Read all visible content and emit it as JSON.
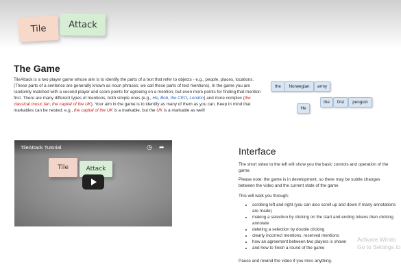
{
  "hero": {
    "logo_tiles": [
      "Tile",
      "Attack"
    ]
  },
  "game": {
    "title": "The Game",
    "intro": [
      {
        "t": "TileAttack is a two player game whose aim is to identify the parts of a text that refer to objects - e.g., people, places, locations. (These parts of a sentence are generally known as noun phrases; we call these parts of text mentions). In the game you are randomly matched with a second player and score points for agreeing on a mention, but even more points for finding that mention first. There are many different types of mentions, both simple ones (e.g., ",
        "s": ""
      },
      {
        "t": "He",
        "s": "blue"
      },
      {
        "t": ", ",
        "s": ""
      },
      {
        "t": "Bob",
        "s": "blue"
      },
      {
        "t": ", ",
        "s": ""
      },
      {
        "t": "the CEO",
        "s": "blue"
      },
      {
        "t": ", ",
        "s": ""
      },
      {
        "t": "London",
        "s": "blue"
      },
      {
        "t": ") and more complex (",
        "s": ""
      },
      {
        "t": "the classical music fan",
        "s": "red"
      },
      {
        "t": ", ",
        "s": ""
      },
      {
        "t": "the capital of the UK",
        "s": "red"
      },
      {
        "t": "). Your aim in the game is to identify as many of them as you can. Keep in mind that markables can be nested: e.g., ",
        "s": ""
      },
      {
        "t": "the capital of the UK",
        "s": "red"
      },
      {
        "t": " is a markable, but the ",
        "s": ""
      },
      {
        "t": "UK",
        "s": "red"
      },
      {
        "t": " is a markable as well!",
        "s": ""
      }
    ],
    "tokens": {
      "row1": [
        "the",
        "Norwegian",
        "army"
      ],
      "row2_single": "He",
      "row2": [
        "the",
        "first",
        "penguin"
      ]
    }
  },
  "video": {
    "title": "TileAttack Tutorial",
    "clock_icon": "clock-icon",
    "share_icon": "share-icon",
    "tiles": [
      "Tile",
      "Attack"
    ]
  },
  "interface": {
    "title": "Interface",
    "p1": "The short video to the left will show you the basic controls and operation of the game.",
    "p2": "Please note: the game is in development, so there may be subtle changes between the video and the current state of the game",
    "p3": "This will walk you through:",
    "steps": [
      "scrolling left and right (you can also scroll up and down if many annotations are made)",
      "making a selection by clicking on the start and ending tokens then clicking annotate",
      "deleting a selection by double clicking",
      "clearly incorrect mentions, reserved mentions",
      "how an agreement between two players is shown",
      "and how to finish a round of the game"
    ],
    "p4": "Pause and rewind the video if you miss anything."
  },
  "watermark": {
    "line1": "Activate Windo",
    "line2": "Go to Settings to ac"
  }
}
